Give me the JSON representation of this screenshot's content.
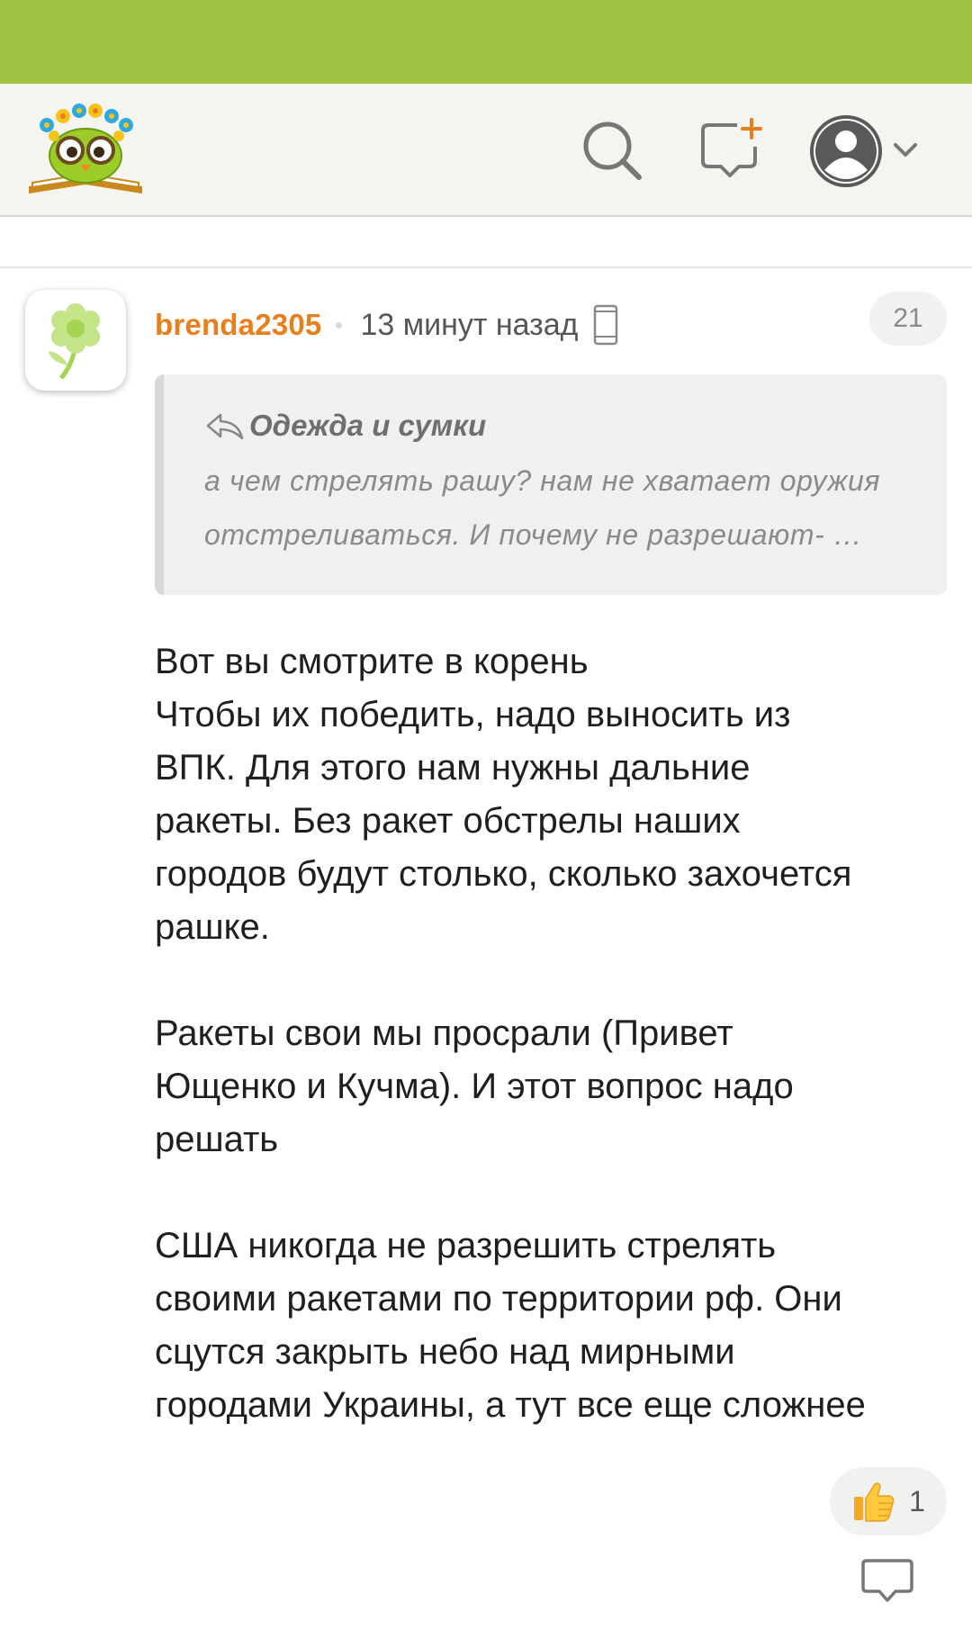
{
  "comment": {
    "username": "brenda2305",
    "time": "13 минут назад",
    "count": "21",
    "quote": {
      "title": "Одежда и сумки",
      "lines": [
        "а чем стрелять рашу? нам не хватает оружия",
        "отстреливаться. И почему не разрешают- …"
      ]
    },
    "body": [
      "Вот вы смотрите в корень",
      "Чтобы их победить, надо выносить из",
      "ВПК. Для этого нам нужны дальние",
      "ракеты. Без ракет обстрелы наших",
      "городов будут столько, сколько захочется",
      "рашке.",
      "",
      "Ракеты свои мы просрали (Привет",
      "Ющенко и Кучма). И этот вопрос надо",
      "решать",
      "",
      "США никогда не разрешить стрелять",
      "своими ракетами по территории рф. Они",
      "сцутся закрыть небо над мирными",
      "городами Украины, а тут все еще сложнее"
    ],
    "likes": "1"
  },
  "icons": {
    "logo": "owl-reading-book-logo",
    "search": "search-icon",
    "new_post": "new-post-icon",
    "profile": "user-avatar-icon",
    "device": "phone-icon",
    "reply_quote": "reply-arrow-icon",
    "like": "thumbs-up-icon",
    "reply": "speech-bubble-icon"
  },
  "colors": {
    "status_bar": "#9dc243",
    "header_bg": "#f5f5ef",
    "username": "#e87e1c",
    "text": "#1f1f1f"
  }
}
